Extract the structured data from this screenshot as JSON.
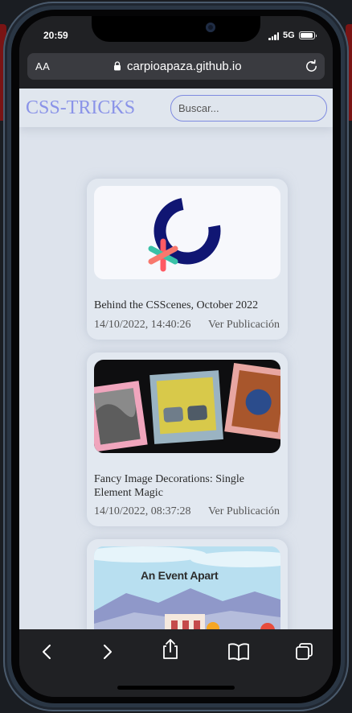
{
  "status": {
    "time": "20:59",
    "network": "5G"
  },
  "browser": {
    "text_size_label": "AA",
    "url": "carpioapaza.github.io"
  },
  "site": {
    "logo": "CSS-TRICKS",
    "search_placeholder": "Buscar..."
  },
  "posts": [
    {
      "title": "Behind the CSScenes, October 2022",
      "date": "14/10/2022, 14:40:26",
      "link": "Ver Publicación"
    },
    {
      "title": "Fancy Image Decorations: Single Element Magic",
      "date": "14/10/2022, 08:37:28",
      "link": "Ver Publicación"
    },
    {
      "title": "",
      "date": "",
      "link": "",
      "image_text": "An Event Apart"
    }
  ],
  "colors": {
    "accent": "#8a93e8",
    "page_bg": "#dde3ec",
    "card_bg": "#e2e8f0",
    "browser_chrome": "#202124"
  },
  "icons": [
    "lock-icon",
    "reload-icon",
    "back-icon",
    "forward-icon",
    "share-icon",
    "bookmarks-icon",
    "tabs-icon"
  ]
}
